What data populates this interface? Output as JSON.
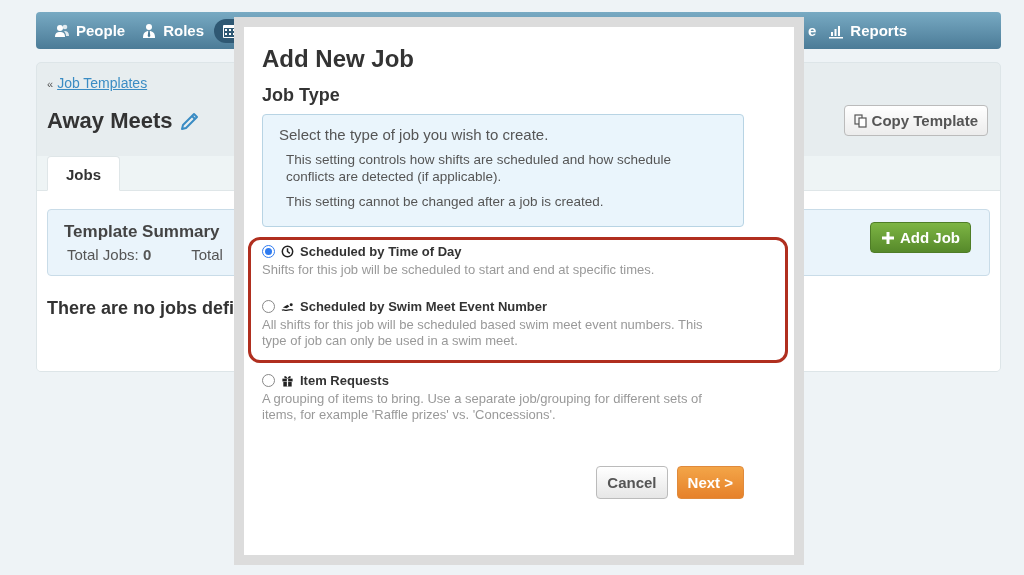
{
  "nav": [
    {
      "kind": "people",
      "label": "People",
      "selected": false
    },
    {
      "kind": "roles",
      "label": "Roles",
      "selected": false
    },
    {
      "kind": "calendar",
      "selected": true
    },
    {
      "kind": "hidden",
      "label": "e",
      "selected": false
    },
    {
      "kind": "reports",
      "label": "Reports",
      "selected": false
    }
  ],
  "breadcrumb": {
    "separator": "«",
    "link": "Job Templates"
  },
  "page_title": "Away Meets",
  "copy_button": "Copy Template",
  "tabs": [
    {
      "label": "Jobs",
      "selected": true
    }
  ],
  "summary": {
    "title": "Template Summary",
    "totals": [
      "Total Jobs: **0**",
      "Total"
    ],
    "add_button": "Add Job"
  },
  "empty_message": "There are no jobs defi",
  "modal": {
    "title": "Add New Job",
    "subtitle": "Job Type",
    "info": {
      "lead": "Select the type of job you wish to create.",
      "notes": [
        "This setting controls how shifts are scheduled and how schedule conflicts are detected (if applicable).",
        "This setting cannot be changed after a job is created."
      ]
    },
    "options": [
      {
        "kind": "clock",
        "label": "Scheduled by Time of Day",
        "description": "Shifts for this job will be scheduled to start and end at specific times.",
        "selected": true,
        "highlighted": true
      },
      {
        "kind": "swimmer",
        "label": "Scheduled by Swim Meet Event Number",
        "description": "All shifts for this job will be scheduled based swim meet event numbers. This type of job can only be used in a swim meet.",
        "selected": false,
        "highlighted": true
      },
      {
        "kind": "gift",
        "label": "Item Requests",
        "description": "A grouping of items to bring. Use a separate job/grouping for different sets of items, for example 'Raffle prizes' vs. 'Concessions'.",
        "selected": false,
        "highlighted": false
      }
    ],
    "buttons": [
      "Cancel",
      "Next >"
    ]
  }
}
